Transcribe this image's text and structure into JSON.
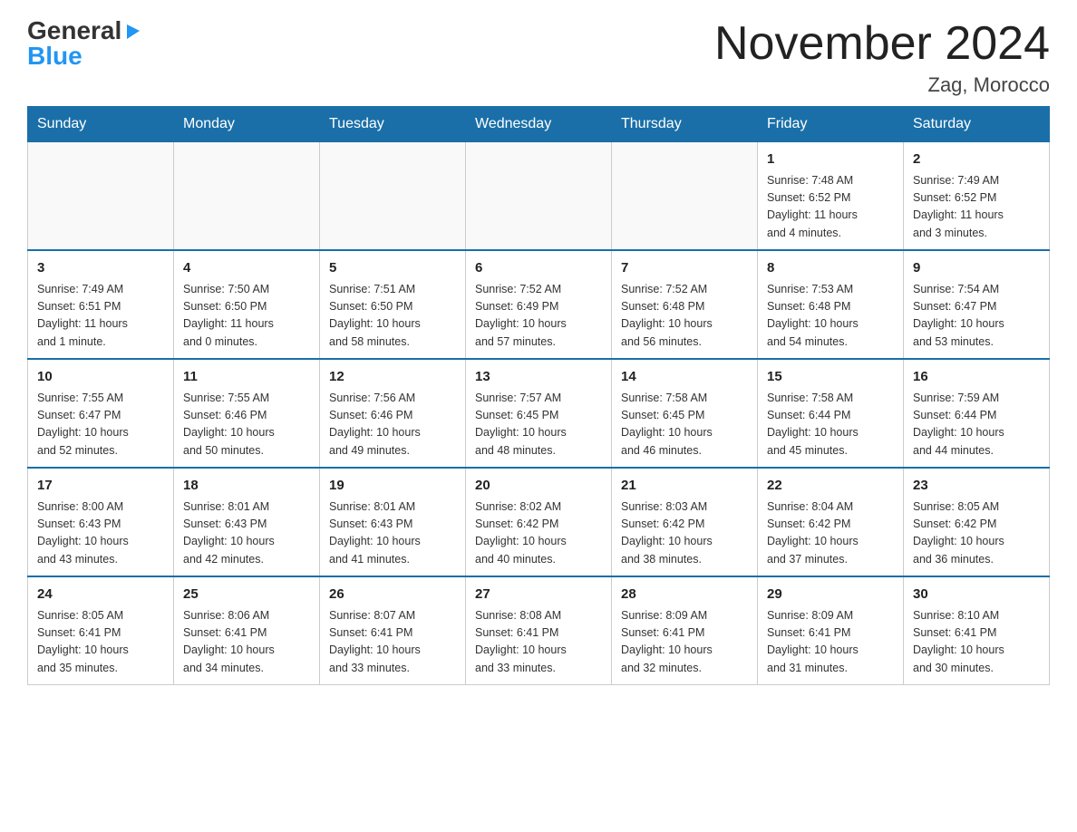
{
  "header": {
    "logo": {
      "general": "General",
      "blue": "Blue",
      "triangle": "▶"
    },
    "title": "November 2024",
    "location": "Zag, Morocco"
  },
  "weekdays": [
    "Sunday",
    "Monday",
    "Tuesday",
    "Wednesday",
    "Thursday",
    "Friday",
    "Saturday"
  ],
  "weeks": [
    [
      {
        "day": "",
        "info": ""
      },
      {
        "day": "",
        "info": ""
      },
      {
        "day": "",
        "info": ""
      },
      {
        "day": "",
        "info": ""
      },
      {
        "day": "",
        "info": ""
      },
      {
        "day": "1",
        "info": "Sunrise: 7:48 AM\nSunset: 6:52 PM\nDaylight: 11 hours\nand 4 minutes."
      },
      {
        "day": "2",
        "info": "Sunrise: 7:49 AM\nSunset: 6:52 PM\nDaylight: 11 hours\nand 3 minutes."
      }
    ],
    [
      {
        "day": "3",
        "info": "Sunrise: 7:49 AM\nSunset: 6:51 PM\nDaylight: 11 hours\nand 1 minute."
      },
      {
        "day": "4",
        "info": "Sunrise: 7:50 AM\nSunset: 6:50 PM\nDaylight: 11 hours\nand 0 minutes."
      },
      {
        "day": "5",
        "info": "Sunrise: 7:51 AM\nSunset: 6:50 PM\nDaylight: 10 hours\nand 58 minutes."
      },
      {
        "day": "6",
        "info": "Sunrise: 7:52 AM\nSunset: 6:49 PM\nDaylight: 10 hours\nand 57 minutes."
      },
      {
        "day": "7",
        "info": "Sunrise: 7:52 AM\nSunset: 6:48 PM\nDaylight: 10 hours\nand 56 minutes."
      },
      {
        "day": "8",
        "info": "Sunrise: 7:53 AM\nSunset: 6:48 PM\nDaylight: 10 hours\nand 54 minutes."
      },
      {
        "day": "9",
        "info": "Sunrise: 7:54 AM\nSunset: 6:47 PM\nDaylight: 10 hours\nand 53 minutes."
      }
    ],
    [
      {
        "day": "10",
        "info": "Sunrise: 7:55 AM\nSunset: 6:47 PM\nDaylight: 10 hours\nand 52 minutes."
      },
      {
        "day": "11",
        "info": "Sunrise: 7:55 AM\nSunset: 6:46 PM\nDaylight: 10 hours\nand 50 minutes."
      },
      {
        "day": "12",
        "info": "Sunrise: 7:56 AM\nSunset: 6:46 PM\nDaylight: 10 hours\nand 49 minutes."
      },
      {
        "day": "13",
        "info": "Sunrise: 7:57 AM\nSunset: 6:45 PM\nDaylight: 10 hours\nand 48 minutes."
      },
      {
        "day": "14",
        "info": "Sunrise: 7:58 AM\nSunset: 6:45 PM\nDaylight: 10 hours\nand 46 minutes."
      },
      {
        "day": "15",
        "info": "Sunrise: 7:58 AM\nSunset: 6:44 PM\nDaylight: 10 hours\nand 45 minutes."
      },
      {
        "day": "16",
        "info": "Sunrise: 7:59 AM\nSunset: 6:44 PM\nDaylight: 10 hours\nand 44 minutes."
      }
    ],
    [
      {
        "day": "17",
        "info": "Sunrise: 8:00 AM\nSunset: 6:43 PM\nDaylight: 10 hours\nand 43 minutes."
      },
      {
        "day": "18",
        "info": "Sunrise: 8:01 AM\nSunset: 6:43 PM\nDaylight: 10 hours\nand 42 minutes."
      },
      {
        "day": "19",
        "info": "Sunrise: 8:01 AM\nSunset: 6:43 PM\nDaylight: 10 hours\nand 41 minutes."
      },
      {
        "day": "20",
        "info": "Sunrise: 8:02 AM\nSunset: 6:42 PM\nDaylight: 10 hours\nand 40 minutes."
      },
      {
        "day": "21",
        "info": "Sunrise: 8:03 AM\nSunset: 6:42 PM\nDaylight: 10 hours\nand 38 minutes."
      },
      {
        "day": "22",
        "info": "Sunrise: 8:04 AM\nSunset: 6:42 PM\nDaylight: 10 hours\nand 37 minutes."
      },
      {
        "day": "23",
        "info": "Sunrise: 8:05 AM\nSunset: 6:42 PM\nDaylight: 10 hours\nand 36 minutes."
      }
    ],
    [
      {
        "day": "24",
        "info": "Sunrise: 8:05 AM\nSunset: 6:41 PM\nDaylight: 10 hours\nand 35 minutes."
      },
      {
        "day": "25",
        "info": "Sunrise: 8:06 AM\nSunset: 6:41 PM\nDaylight: 10 hours\nand 34 minutes."
      },
      {
        "day": "26",
        "info": "Sunrise: 8:07 AM\nSunset: 6:41 PM\nDaylight: 10 hours\nand 33 minutes."
      },
      {
        "day": "27",
        "info": "Sunrise: 8:08 AM\nSunset: 6:41 PM\nDaylight: 10 hours\nand 33 minutes."
      },
      {
        "day": "28",
        "info": "Sunrise: 8:09 AM\nSunset: 6:41 PM\nDaylight: 10 hours\nand 32 minutes."
      },
      {
        "day": "29",
        "info": "Sunrise: 8:09 AM\nSunset: 6:41 PM\nDaylight: 10 hours\nand 31 minutes."
      },
      {
        "day": "30",
        "info": "Sunrise: 8:10 AM\nSunset: 6:41 PM\nDaylight: 10 hours\nand 30 minutes."
      }
    ]
  ]
}
